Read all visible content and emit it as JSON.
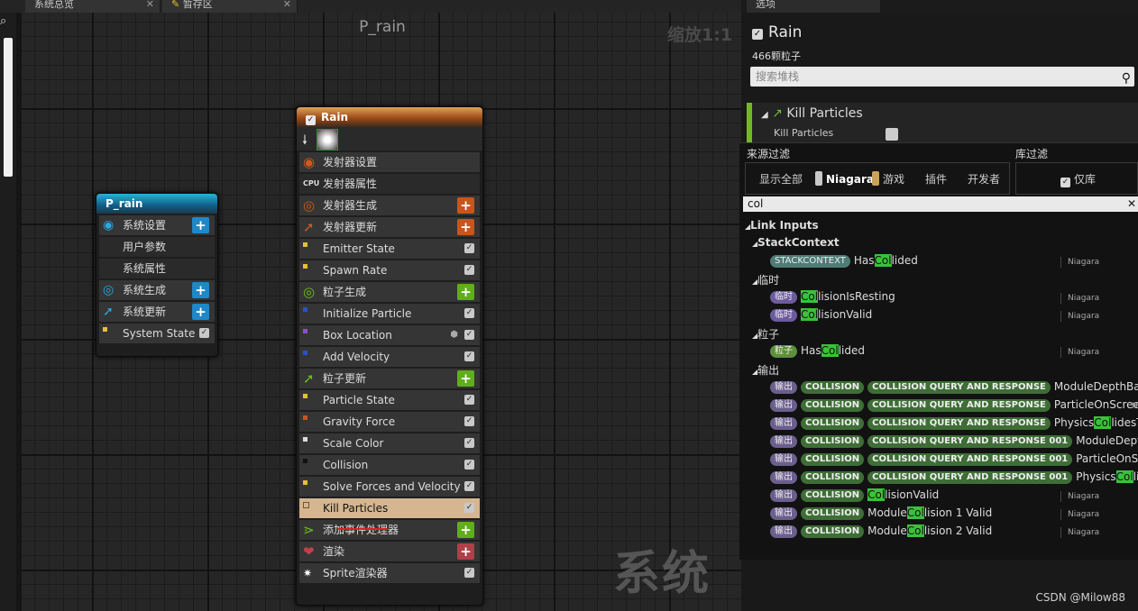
{
  "tabs": [
    {
      "label": "系统总览"
    },
    {
      "label": "暂存区"
    }
  ],
  "graph": {
    "title": "P_rain",
    "zoom": "缩放1:1",
    "watermark": "系统"
  },
  "system_node": {
    "title": "P_rain",
    "rows": [
      {
        "label": "系统设置",
        "kind": "section"
      },
      {
        "label": "用户参数",
        "kind": "sub"
      },
      {
        "label": "系统属性",
        "kind": "sub"
      },
      {
        "label": "系统生成",
        "kind": "section"
      },
      {
        "label": "系统更新",
        "kind": "section"
      },
      {
        "label": "System State",
        "kind": "module"
      }
    ]
  },
  "emitter_node": {
    "title": "Rain",
    "rows": [
      {
        "label": "发射器设置",
        "kind": "section"
      },
      {
        "label": "发射器属性",
        "kind": "sub"
      },
      {
        "label": "发射器生成",
        "kind": "section"
      },
      {
        "label": "发射器更新",
        "kind": "section"
      },
      {
        "label": "Emitter State",
        "kind": "module"
      },
      {
        "label": "Spawn Rate",
        "kind": "module"
      },
      {
        "label": "粒子生成",
        "kind": "section"
      },
      {
        "label": "Initialize Particle",
        "kind": "module"
      },
      {
        "label": "Box Location",
        "kind": "module"
      },
      {
        "label": "Add Velocity",
        "kind": "module"
      },
      {
        "label": "粒子更新",
        "kind": "section"
      },
      {
        "label": "Particle State",
        "kind": "module"
      },
      {
        "label": "Gravity Force",
        "kind": "module"
      },
      {
        "label": "Scale Color",
        "kind": "module"
      },
      {
        "label": "Collision",
        "kind": "module"
      },
      {
        "label": "Solve Forces and Velocity",
        "kind": "module"
      },
      {
        "label": "Kill Particles",
        "kind": "module"
      },
      {
        "label": "添加事件处理器",
        "kind": "section"
      },
      {
        "label": "渲染",
        "kind": "section"
      },
      {
        "label": "Sprite渲染器",
        "kind": "module"
      }
    ]
  },
  "panel": {
    "tab": "选项",
    "title": "Rain",
    "count": "466颗粒子",
    "search_placeholder": "搜索堆栈",
    "kill_header": "Kill Particles",
    "kill_row": "Kill Particles"
  },
  "popup": {
    "source_filter": "来源过滤",
    "library_filter": "库过滤",
    "options": [
      "显示全部",
      "Niagara",
      "游戏",
      "插件",
      "开发者"
    ],
    "library_only": "仅库",
    "search_value": "col",
    "tree_root": "Link Inputs",
    "groups": [
      {
        "name": "StackContext",
        "items": [
          {
            "pill": "STACKCONTEXT",
            "pre": "Has",
            "hl": "Col",
            "post": "lided",
            "src": "Niagara"
          }
        ]
      },
      {
        "name": "临时",
        "items": [
          {
            "pill": "临时",
            "pre": "",
            "hl": "Col",
            "post": "lisionIsResting",
            "src": "Niagara"
          },
          {
            "pill": "临时",
            "pre": "",
            "hl": "Col",
            "post": "lisionValid",
            "src": "Niagara"
          }
        ]
      },
      {
        "name": "粒子",
        "items": [
          {
            "pill": "粒子",
            "pre": "Has",
            "hl": "Col",
            "post": "lided",
            "src": "Niagara"
          }
        ]
      },
      {
        "name": "输出",
        "items": [
          {
            "pill": "输出",
            "pill2": "COLLISION",
            "pill3": "COLLISION QUERY AND RESPONSE",
            "pre": "ModuleDepthBased",
            "hl": "",
            "post": "",
            "src": ""
          },
          {
            "pill": "输出",
            "pill2": "COLLISION",
            "pill3": "COLLISION QUERY AND RESPONSE",
            "pre": "ParticleOnScreen",
            "hl": "",
            "post": "",
            "src": "N"
          },
          {
            "pill": "输出",
            "pill2": "COLLISION",
            "pill3": "COLLISION QUERY AND RESPONSE",
            "pre": "Physics",
            "hl": "Col",
            "post": "lidesThi",
            "src": ""
          },
          {
            "pill": "输出",
            "pill2": "COLLISION",
            "pill3": "COLLISION QUERY AND RESPONSE 001",
            "pre": "ModuleDepthBa",
            "hl": "",
            "post": "",
            "src": ""
          },
          {
            "pill": "输出",
            "pill2": "COLLISION",
            "pill3": "COLLISION QUERY AND RESPONSE 001",
            "pre": "ParticleOnScree",
            "hl": "",
            "post": "",
            "src": ""
          },
          {
            "pill": "输出",
            "pill2": "COLLISION",
            "pill3": "COLLISION QUERY AND RESPONSE 001",
            "pre": "Physics",
            "hl": "Col",
            "post": "lides",
            "src": ""
          },
          {
            "pill": "输出",
            "pill2": "COLLISION",
            "pill3": "",
            "pre": "",
            "hl": "Col",
            "post": "lisionValid",
            "src": "Niagara"
          },
          {
            "pill": "输出",
            "pill2": "COLLISION",
            "pill3": "",
            "pre": "Module",
            "hl": "Col",
            "post": "lision 1 Valid",
            "src": "Niagara"
          },
          {
            "pill": "输出",
            "pill2": "COLLISION",
            "pill3": "",
            "pre": "Module",
            "hl": "Col",
            "post": "lision 2 Valid",
            "src": "Niagara"
          }
        ]
      }
    ]
  },
  "credit": "CSDN @Milow88",
  "colors": {
    "accent_green": "#74b82a",
    "emitter_orange": "#c8561c",
    "system_blue": "#1e88c8",
    "highlight": "#3ac23a"
  }
}
